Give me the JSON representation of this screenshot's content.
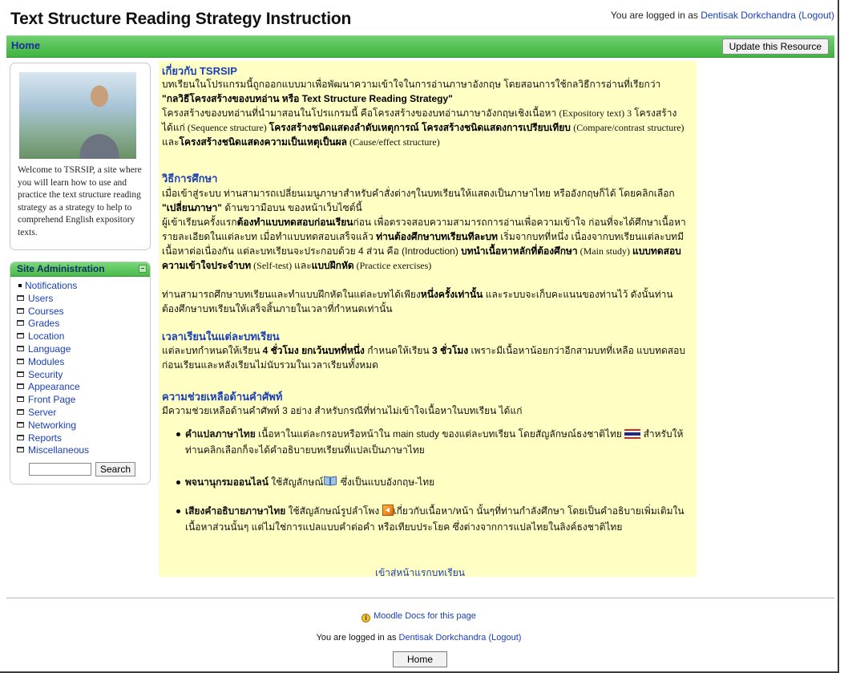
{
  "header": {
    "site_title": "Text Structure Reading Strategy Instruction",
    "login_prefix": "You are logged in as",
    "user_name": "Dentisak Dorkchandra",
    "logout": "(Logout)"
  },
  "navbar": {
    "home": "Home",
    "update_button": "Update this Resource"
  },
  "sidebar": {
    "welcome_text": "Welcome to TSRSIP, a site where you will learn how to use and practice the text structure reading strategy as a strategy to help to comprehend English expository texts.",
    "admin": {
      "title": "Site Administration",
      "items": [
        {
          "label": "Notifications",
          "icon": "bullet"
        },
        {
          "label": "Users",
          "icon": "folder"
        },
        {
          "label": "Courses",
          "icon": "folder"
        },
        {
          "label": "Grades",
          "icon": "folder"
        },
        {
          "label": "Location",
          "icon": "folder"
        },
        {
          "label": "Language",
          "icon": "folder"
        },
        {
          "label": "Modules",
          "icon": "folder"
        },
        {
          "label": "Security",
          "icon": "folder"
        },
        {
          "label": "Appearance",
          "icon": "folder"
        },
        {
          "label": "Front Page",
          "icon": "folder"
        },
        {
          "label": "Server",
          "icon": "folder"
        },
        {
          "label": "Networking",
          "icon": "folder"
        },
        {
          "label": "Reports",
          "icon": "folder"
        },
        {
          "label": "Miscellaneous",
          "icon": "folder"
        }
      ],
      "search_button": "Search"
    }
  },
  "content": {
    "about_heading": "เกี่ยวกับ TSRSIP",
    "about_p1a": "บทเรียนในโปรแกรมนี้ถูกออกแบบมาเพื่อพัฒนาความเข้าใจในการอ่านภาษาอังกฤษ โดยสอนการใช้กลวิธีการอ่านที่เรียกว่า ",
    "about_p1b": "\"กลวิธีโครงสร้างของบทอ่าน หรือ Text Structure Reading Strategy\"",
    "about_p2a": "โครงสร้างของบทอ่านที่นำมาสอนในโปรแกรมนี้ คือโครงสร้างของบทอ่านภาษาอังกฤษเชิงเนื้อหา ",
    "about_p2b": "(Expository text) 3 โครงสร้าง ได้แก่ (Sequence structure) ",
    "about_p2c": "โครงสร้างชนิดแสดงลำดับเหตุการณ์ โครงสร้างชนิดแสดงการเปรียบเทียบ ",
    "about_p2d": "(Compare/contrast structure) และ",
    "about_p2e": "โครงสร้างชนิดแสดงความเป็นเหตุเป็นผล",
    "about_p2f": " (Cause/effect structure)",
    "study_heading": "วิธีการศึกษา",
    "study_p1a": "เมื่อเข้าสู่ระบบ ท่านสามารถเปลี่ยนเมนูภาษาสำหรับคำสั่งต่างๆในบทเรียนให้แสดงเป็นภาษาไทย หรืออังกฤษก็ได้ โดยคลิกเลือก ",
    "study_p1b": "\"เปลี่ยนภาษา\"",
    "study_p1c": " ด้านขวามือบน ของหน้าเว็บไซต์นี้",
    "study_p2a": "ผู้เข้าเรียนครั้งแรก",
    "study_p2b": "ต้องทำแบบทดสอบก่อนเรียน",
    "study_p2c": "ก่อน เพื่อตรวจสอบความสามารถการอ่านเพื่อความเข้าใจ ก่อนที่จะได้ศึกษาเนื้อหารายละเอียดในแต่ละบท เมื่อทำแบบทดสอบเสร็จแล้ว ",
    "study_p2d": "ท่านต้องศึกษาบทเรียนทีละบท",
    "study_p2e": " เริ่มจากบทที่หนึ่ง เนื่องจากบทเรียนแต่ละบทมีเนื้อหาต่อเนื่องกัน แต่ละบทเรียนจะประกอบด้วย 4 ส่วน คือ (Introduction) ",
    "study_p2f": "บทนำเนื้อหาหลักที่ต้องศึกษา",
    "study_p2g": " (Main study) ",
    "study_p2h": "แบบทดสอบความเข้าใจประจำบท",
    "study_p2i": " (Self-test) และ",
    "study_p2j": "แบบฝึกหัด",
    "study_p2k": " (Practice exercises)",
    "study_p3a": "ท่านสามารถศึกษาบทเรียนและทำแบบฝึกหัดในแต่ละบทได้เพียง",
    "study_p3b": "หนึ่งครั้งเท่านั้น",
    "study_p3c": " และระบบจะเก็บคะแนนของท่านไว้ ดังนั้นท่านต้องศึกษาบทเรียนให้เสร็จสิ้นภายในเวลาที่กำหนดเท่านั้น",
    "time_heading": "เวลาเรียนในแต่ละบทเรียน",
    "time_p1a": "แต่ละบทกำหนดให้เรียน ",
    "time_p1b": "4 ชั่วโมง ยกเว้นบทที่หนึ่ง",
    "time_p1c": " กำหนดให้เรียน ",
    "time_p1d": "3 ชั่วโมง",
    "time_p1e": " เพราะมีเนื้อหาน้อยกว่าอีกสามบทที่เหลือ แบบทดสอบก่อนเรียนและหลังเรียนไม่นับรวมในเวลาเรียนทั้งหมด",
    "vocab_heading": "ความช่วยเหลือด้านคำศัพท์",
    "vocab_p1": "มีความช่วยเหลือด้านคำศัพท์ 3 อย่าง สำหรับกรณีที่ท่านไม่เข้าใจเนื้อหาในบทเรียน ได้แก่",
    "bullet1a": "คำแปลภาษาไทย",
    "bullet1b": " เนื้อหาในแต่ละกรอบหรือหน้าใน main study ของแต่ละบทเรียน โดยสัญลักษณ์ธงชาติไทย ",
    "bullet1c": " สำหรับให้ท่านคลิกเลือกก็จะได้คำอธิบายบทเรียนที่แปลเป็นภาษาไทย",
    "bullet2a": "พจนานุกรมออนไลน์",
    "bullet2b": " ใช้สัญลักษณ์",
    "bullet2c": " ซึ่งเป็นแบบอังกฤษ-ไทย",
    "bullet3a": "เสียงคำอธิบายภาษาไทย",
    "bullet3b": " ใช้สัญลักษณ์รูปลำโพง ",
    "bullet3c": "เกี่ยวกับเนื้อหา/หน้า นั้นๆที่ท่านกำลังศึกษา โดยเป็นคำอธิบายเพิ่มเติมในเนื้อหาส่วนนั้นๆ แต่ไม่ใช่การแปลแบบคำต่อคำ หรือเทียบประโยค ซึ่งต่างจากการแปลไทยในลิงค์ธงชาติไทย",
    "enter_link": "เข้าสู่หน้าแรกบทเรียน"
  },
  "footer": {
    "docs_link": "Moodle Docs for this page",
    "login_prefix": "You are logged in as",
    "user_name": "Dentisak Dorkchandra",
    "logout": "(Logout)",
    "home_button": "Home"
  }
}
